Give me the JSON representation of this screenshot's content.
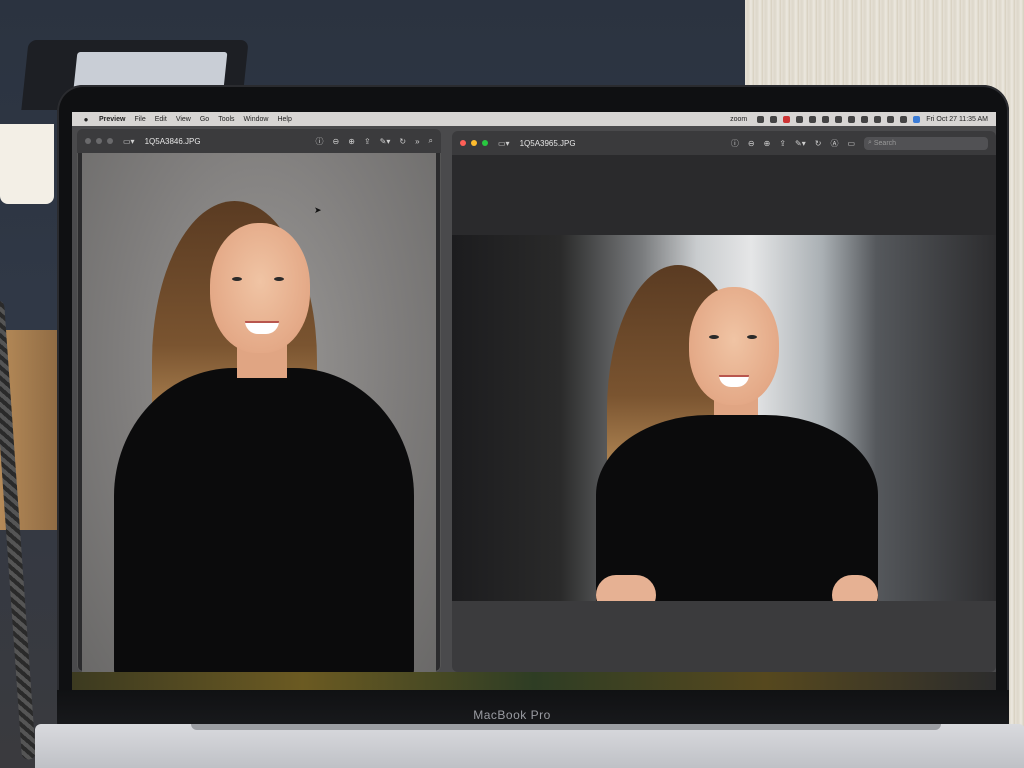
{
  "menubar": {
    "app_name": "Preview",
    "menus": [
      "File",
      "Edit",
      "View",
      "Go",
      "Tools",
      "Window",
      "Help"
    ],
    "status_zoom": "zoom",
    "datetime": "Fri Oct 27  11:35 AM"
  },
  "windows": {
    "left": {
      "filename": "1Q5A3846.JPG"
    },
    "right": {
      "filename": "1Q5A3965.JPG",
      "search_placeholder": "Search"
    }
  },
  "device": {
    "brand_label": "MacBook Pro"
  },
  "icons": {
    "info": "info-icon",
    "zoom_out": "zoom-out-icon",
    "zoom_in": "zoom-in-icon",
    "share": "share-icon",
    "markup": "pen-icon",
    "rotate": "rotate-icon",
    "more": "chevrons-right-icon",
    "search": "search-icon"
  },
  "colors": {
    "traffic_red": "#ff5f57",
    "traffic_yellow": "#febc2e",
    "traffic_green": "#28c840",
    "toolbar": "#3a3a3c"
  }
}
